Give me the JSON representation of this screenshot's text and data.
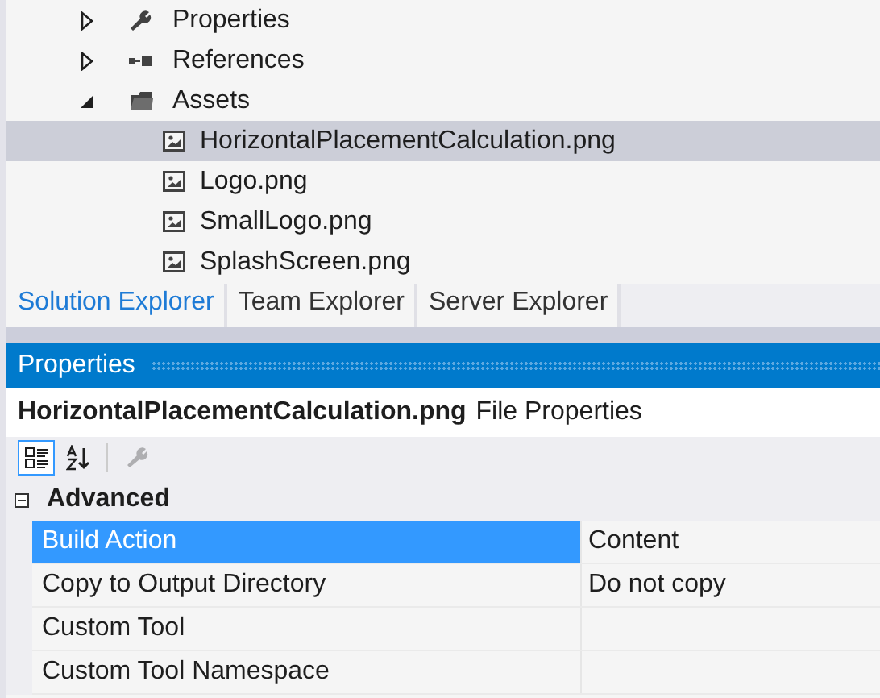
{
  "solution_tree": [
    {
      "label": "Properties",
      "kind": "properties",
      "expanded": false,
      "selected": false
    },
    {
      "label": "References",
      "kind": "references",
      "expanded": false,
      "selected": false
    },
    {
      "label": "Assets",
      "kind": "folder",
      "expanded": true,
      "selected": false,
      "children": [
        {
          "label": "HorizontalPlacementCalculation.png",
          "kind": "image",
          "selected": true
        },
        {
          "label": "Logo.png",
          "kind": "image",
          "selected": false
        },
        {
          "label": "SmallLogo.png",
          "kind": "image",
          "selected": false
        },
        {
          "label": "SplashScreen.png",
          "kind": "image",
          "selected": false
        }
      ]
    }
  ],
  "tabs": [
    {
      "label": "Solution Explorer",
      "selected": true
    },
    {
      "label": "Team Explorer",
      "selected": false
    },
    {
      "label": "Server Explorer",
      "selected": false
    }
  ],
  "properties_panel": {
    "title": "Properties",
    "object_name": "HorizontalPlacementCalculation.png",
    "object_type": "File Properties",
    "toolbar": [
      {
        "kind": "categorized",
        "selected": true,
        "disabled": false
      },
      {
        "kind": "alphabetical",
        "selected": false,
        "disabled": false
      },
      {
        "kind": "property-pages",
        "selected": false,
        "disabled": true
      }
    ],
    "categories": [
      {
        "name": "Advanced",
        "expanded": true,
        "rows": [
          {
            "name": "Build Action",
            "value": "Content",
            "selected": true
          },
          {
            "name": "Copy to Output Directory",
            "value": "Do not copy",
            "selected": false
          },
          {
            "name": "Custom Tool",
            "selected": false
          },
          {
            "name": "Custom Tool Namespace",
            "selected": false
          }
        ]
      }
    ]
  }
}
